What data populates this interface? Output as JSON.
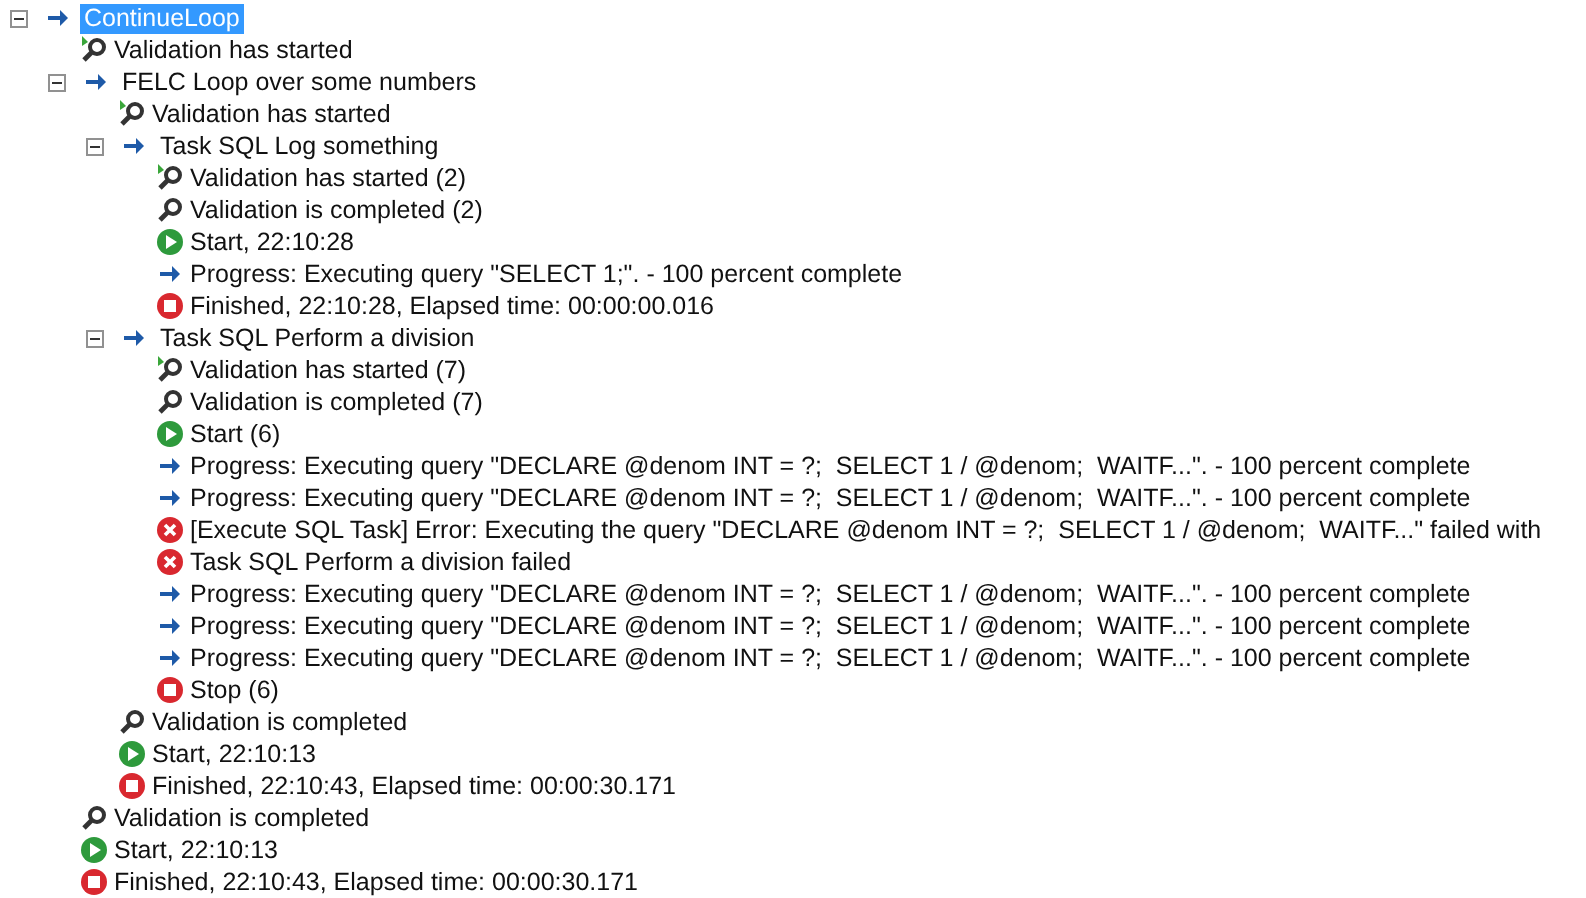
{
  "tree": [
    {
      "kind": "node",
      "label": "ContinueLoop",
      "selected": true,
      "expanded": true,
      "children": [
        {
          "kind": "validation-started",
          "label": "Validation has started"
        },
        {
          "kind": "node",
          "label": "FELC Loop over some numbers",
          "selected": false,
          "expanded": true,
          "children": [
            {
              "kind": "validation-started",
              "label": "Validation has started"
            },
            {
              "kind": "node",
              "label": "Task SQL Log something",
              "selected": false,
              "expanded": true,
              "children": [
                {
                  "kind": "validation-started",
                  "label": "Validation has started (2)"
                },
                {
                  "kind": "validation-completed",
                  "label": "Validation is completed (2)"
                },
                {
                  "kind": "start",
                  "label": "Start, 22:10:28"
                },
                {
                  "kind": "progress",
                  "label": "Progress: Executing query \"SELECT 1;\". - 100 percent complete"
                },
                {
                  "kind": "stop",
                  "label": "Finished, 22:10:28, Elapsed time: 00:00:00.016"
                }
              ]
            },
            {
              "kind": "node",
              "label": "Task SQL Perform a division",
              "selected": false,
              "expanded": true,
              "children": [
                {
                  "kind": "validation-started",
                  "label": "Validation has started (7)"
                },
                {
                  "kind": "validation-completed",
                  "label": "Validation is completed (7)"
                },
                {
                  "kind": "start",
                  "label": "Start (6)"
                },
                {
                  "kind": "progress",
                  "label": "Progress: Executing query \"DECLARE @denom INT = ?;  SELECT 1 / @denom;  WAITF...\". - 100 percent complete"
                },
                {
                  "kind": "progress",
                  "label": "Progress: Executing query \"DECLARE @denom INT = ?;  SELECT 1 / @denom;  WAITF...\". - 100 percent complete"
                },
                {
                  "kind": "error",
                  "label": "[Execute SQL Task] Error: Executing the query \"DECLARE @denom INT = ?;  SELECT 1 / @denom;  WAITF...\" failed with"
                },
                {
                  "kind": "error",
                  "label": "Task SQL Perform a division failed"
                },
                {
                  "kind": "progress",
                  "label": "Progress: Executing query \"DECLARE @denom INT = ?;  SELECT 1 / @denom;  WAITF...\". - 100 percent complete"
                },
                {
                  "kind": "progress",
                  "label": "Progress: Executing query \"DECLARE @denom INT = ?;  SELECT 1 / @denom;  WAITF...\". - 100 percent complete"
                },
                {
                  "kind": "progress",
                  "label": "Progress: Executing query \"DECLARE @denom INT = ?;  SELECT 1 / @denom;  WAITF...\". - 100 percent complete"
                },
                {
                  "kind": "stop",
                  "label": "Stop (6)"
                }
              ]
            },
            {
              "kind": "validation-completed",
              "label": "Validation is completed"
            },
            {
              "kind": "start",
              "label": "Start, 22:10:13"
            },
            {
              "kind": "stop",
              "label": "Finished, 22:10:43, Elapsed time: 00:00:30.171"
            }
          ]
        },
        {
          "kind": "validation-completed",
          "label": "Validation is completed"
        },
        {
          "kind": "start",
          "label": "Start, 22:10:13"
        },
        {
          "kind": "stop",
          "label": "Finished, 22:10:43, Elapsed time: 00:00:30.171"
        }
      ]
    }
  ]
}
